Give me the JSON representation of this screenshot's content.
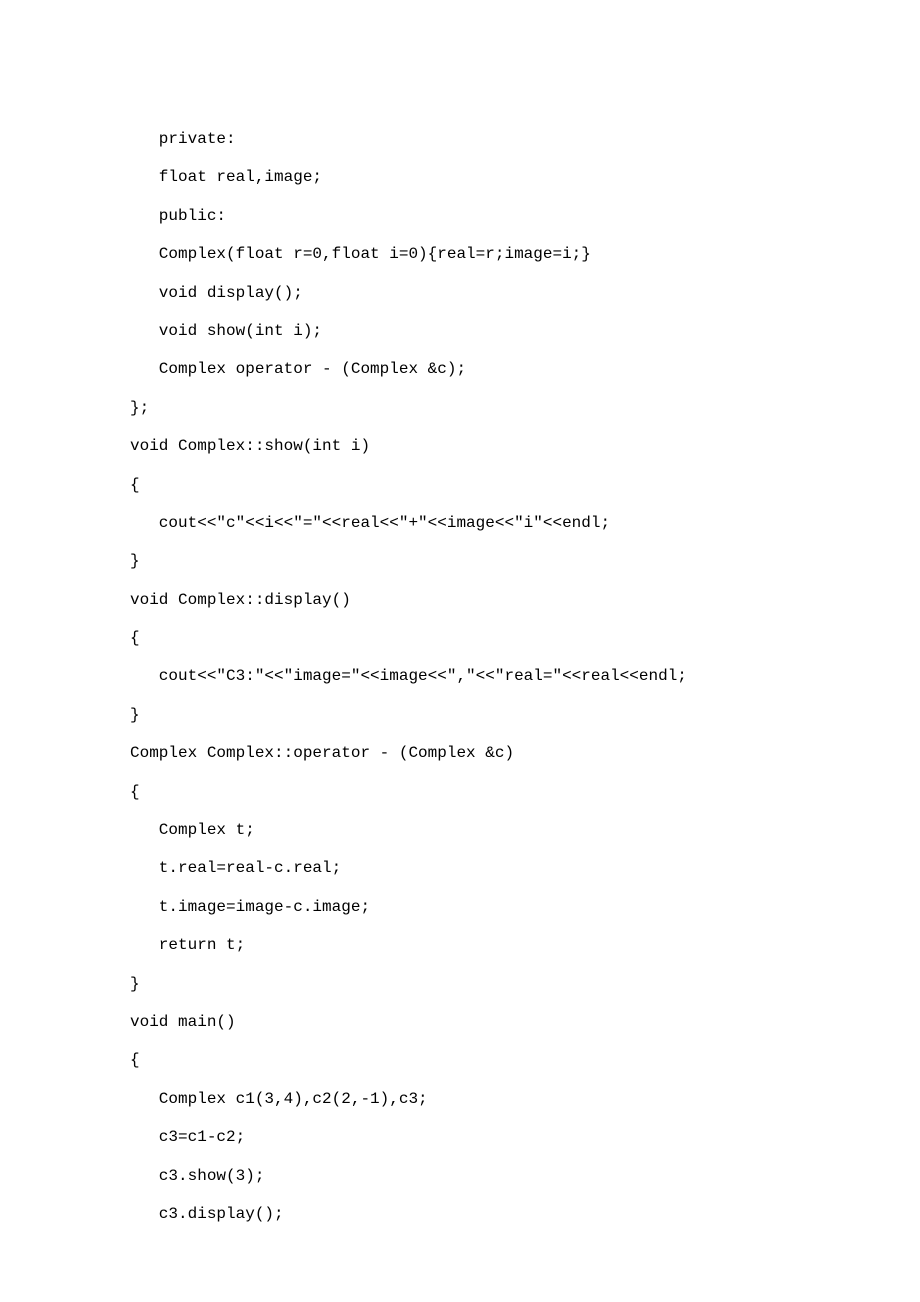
{
  "code_lines": [
    "   private:",
    "   float real,image;",
    "   public:",
    "   Complex(float r=0,float i=0){real=r;image=i;}",
    "   void display();",
    "   void show(int i);",
    "   Complex operator - (Complex &c);",
    "};",
    "void Complex::show(int i)",
    "{",
    "   cout<<\"c\"<<i<<\"=\"<<real<<\"+\"<<image<<\"i\"<<endl;",
    "}",
    "void Complex::display()",
    "{",
    "   cout<<\"C3:\"<<\"image=\"<<image<<\",\"<<\"real=\"<<real<<endl;",
    "}",
    "Complex Complex::operator - (Complex &c)",
    "{",
    "   Complex t;",
    "   t.real=real-c.real;",
    "   t.image=image-c.image;",
    "   return t;",
    "}",
    "void main()",
    "{",
    "   Complex c1(3,4),c2(2,-1),c3;",
    "   c3=c1-c2;",
    "   c3.show(3);",
    "   c3.display();"
  ]
}
